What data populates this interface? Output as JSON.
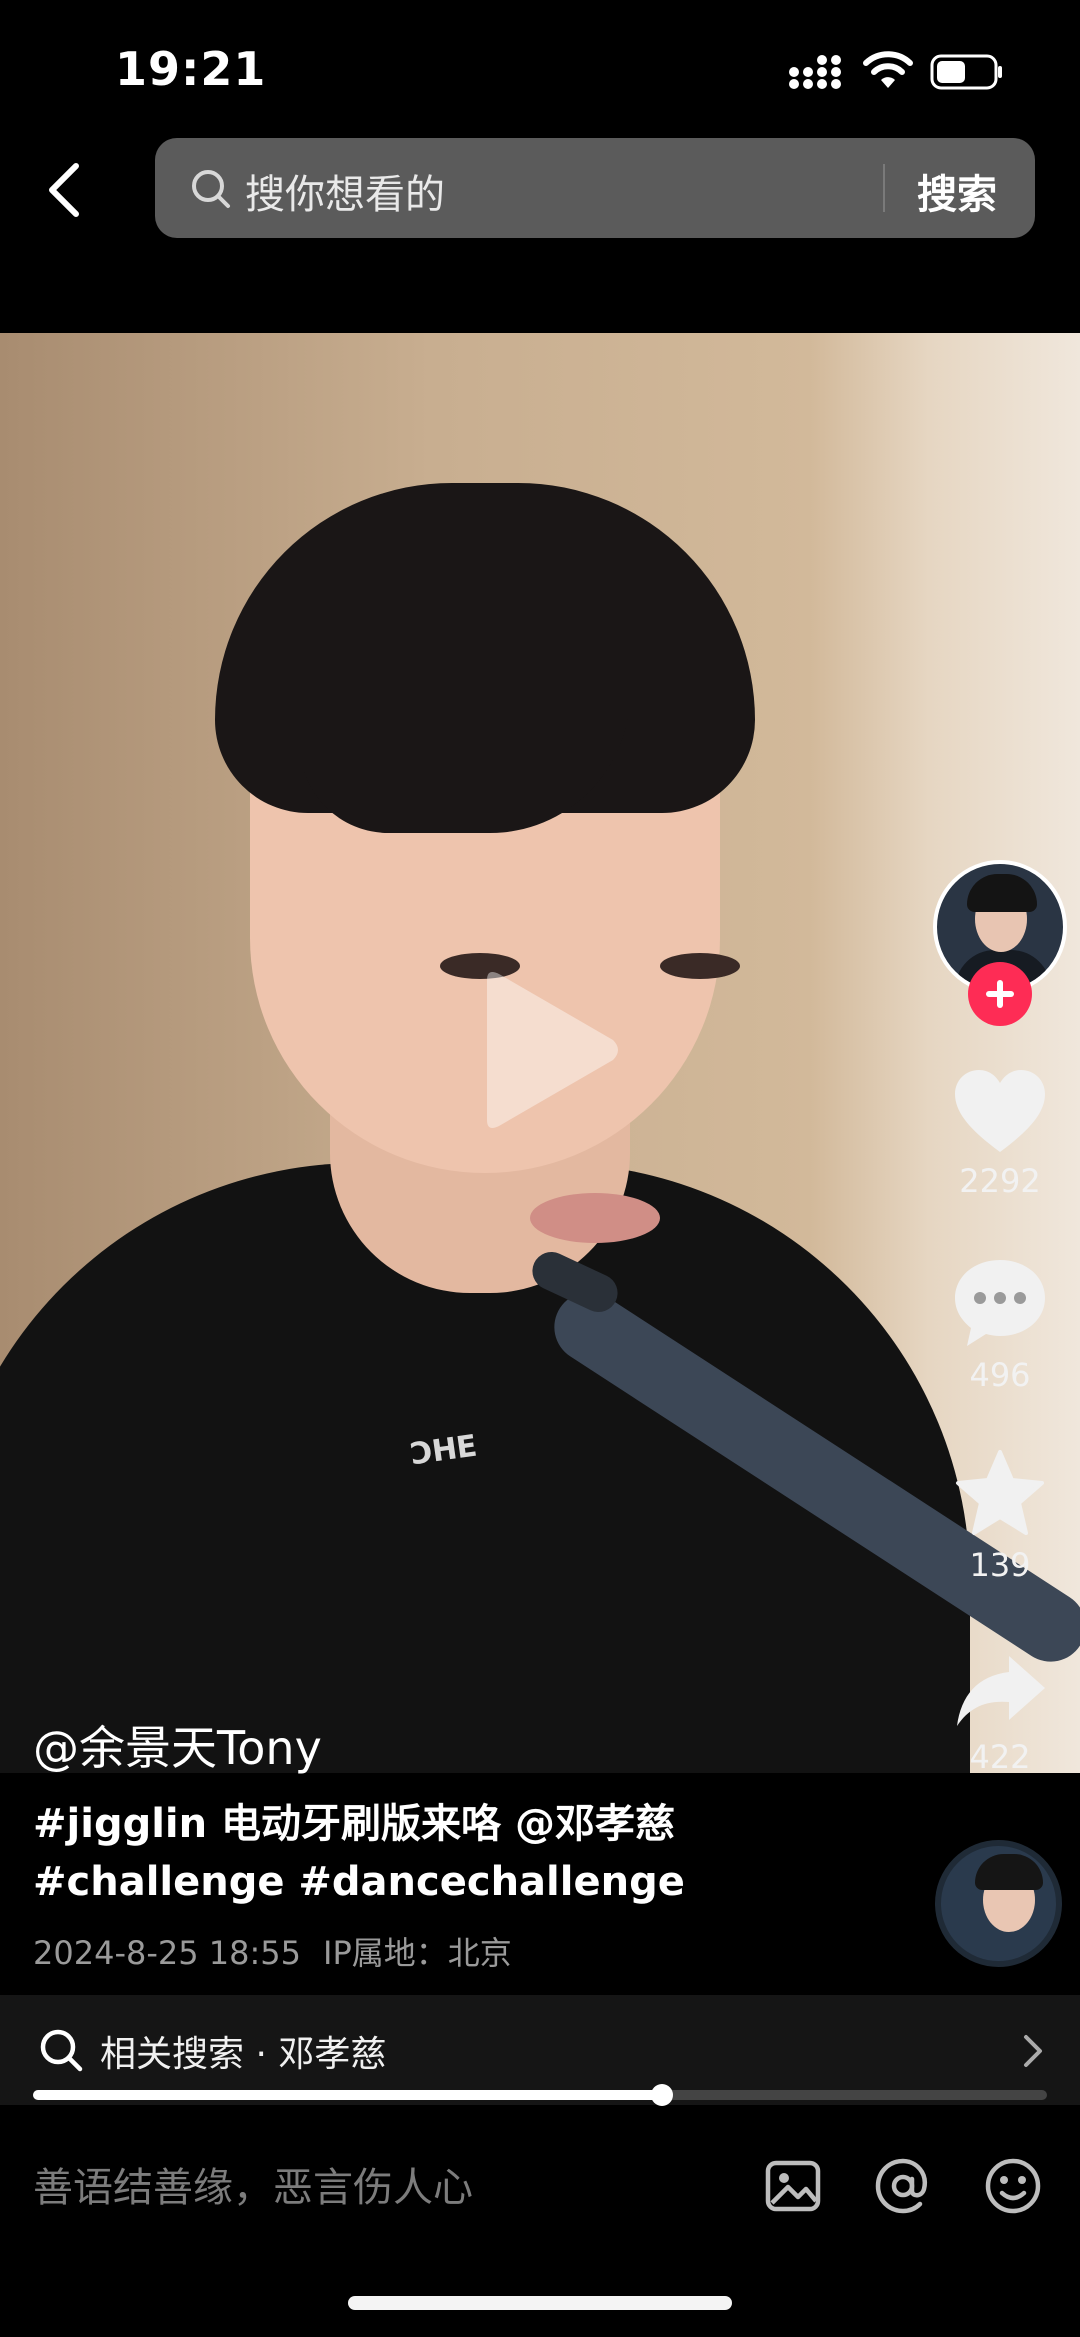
{
  "status_bar": {
    "time": "19:21"
  },
  "header": {
    "search_placeholder": "搜你想看的",
    "search_button": "搜索"
  },
  "video": {
    "shirt_logo": "ƎHC",
    "progress": 0.62,
    "actions": {
      "likes": "2292",
      "comments": "496",
      "favorites": "139",
      "shares": "422"
    }
  },
  "post": {
    "author": "@余景天Tony",
    "caption_line1": "#jigglin 电动牙刷版来咯 @邓孝慈",
    "caption_line2": "#challenge #dancechallenge",
    "date": "2024-8-25 18:55",
    "ip_location": "IP属地：北京"
  },
  "related_search": {
    "label": "相关搜索 · 邓孝慈"
  },
  "comment_bar": {
    "placeholder": "善语结善缘，恶言伤人心"
  },
  "colors": {
    "follow_badge": "#fe2c55",
    "background": "#000000",
    "search_bar": "#5b5b5b"
  }
}
